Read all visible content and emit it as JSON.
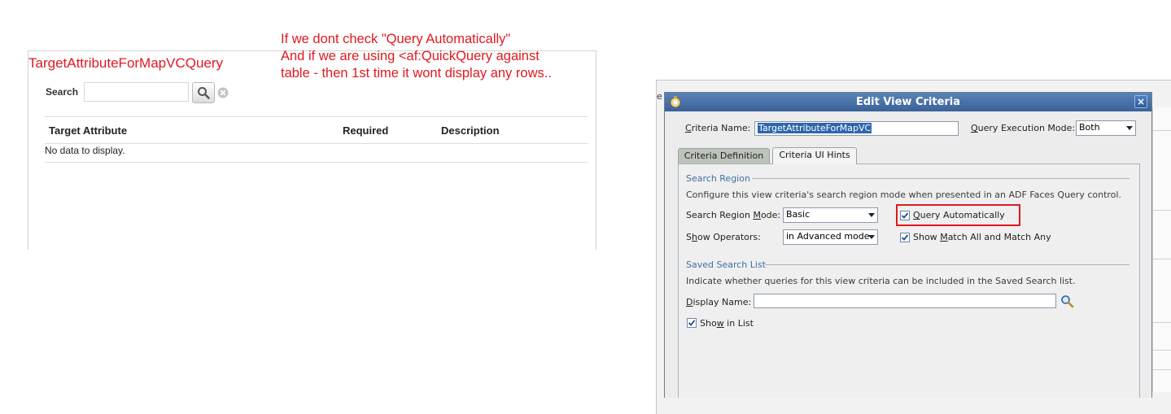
{
  "annotation": {
    "heading": "TargetAttributeForMapVCQuery",
    "lines": [
      "If we dont check \"Query Automatically\"",
      "And if we are using <af:QuickQuery against",
      "table - then 1st time it wont display any rows.."
    ],
    "color": "#e0191f"
  },
  "left_page": {
    "search_label": "Search",
    "search_value": "",
    "table": {
      "columns": [
        "Target Attribute",
        "Required",
        "Description"
      ],
      "empty_text": "No data to display."
    }
  },
  "background_window": {
    "edge_text": "e"
  },
  "dialog": {
    "title": "Edit View Criteria",
    "close_label": "×",
    "criteria_name_label": "Criteria Name:",
    "criteria_name_value": "TargetAttributeForMapVC",
    "query_exec_mode_label": "Query Execution Mode:",
    "query_exec_mode_value": "Both",
    "tabs": [
      {
        "label": "Criteria Definition",
        "active": false
      },
      {
        "label": "Criteria UI Hints",
        "active": true
      }
    ],
    "search_region": {
      "title": "Search Region",
      "description": "Configure this view criteria's search region mode when presented in an ADF Faces Query control.",
      "mode_label": "Search Region Mode:",
      "mode_value": "Basic",
      "show_operators_label": "Show Operators:",
      "show_operators_value": "in Advanced mode",
      "query_automatically_label": "Query Automatically",
      "query_automatically_checked": true,
      "show_match_label": "Show Match All and Match Any",
      "show_match_checked": true
    },
    "saved_search": {
      "title": "Saved Search List",
      "description": "Indicate whether queries for this view criteria can be included in the Saved Search list.",
      "display_name_label": "Display Name:",
      "display_name_value": "",
      "show_in_list_label": "Show in List",
      "show_in_list_checked": true
    },
    "colors": {
      "title_bar": "#3a6299",
      "section_title": "#3f6fa5",
      "highlight": "#e0191f"
    }
  }
}
